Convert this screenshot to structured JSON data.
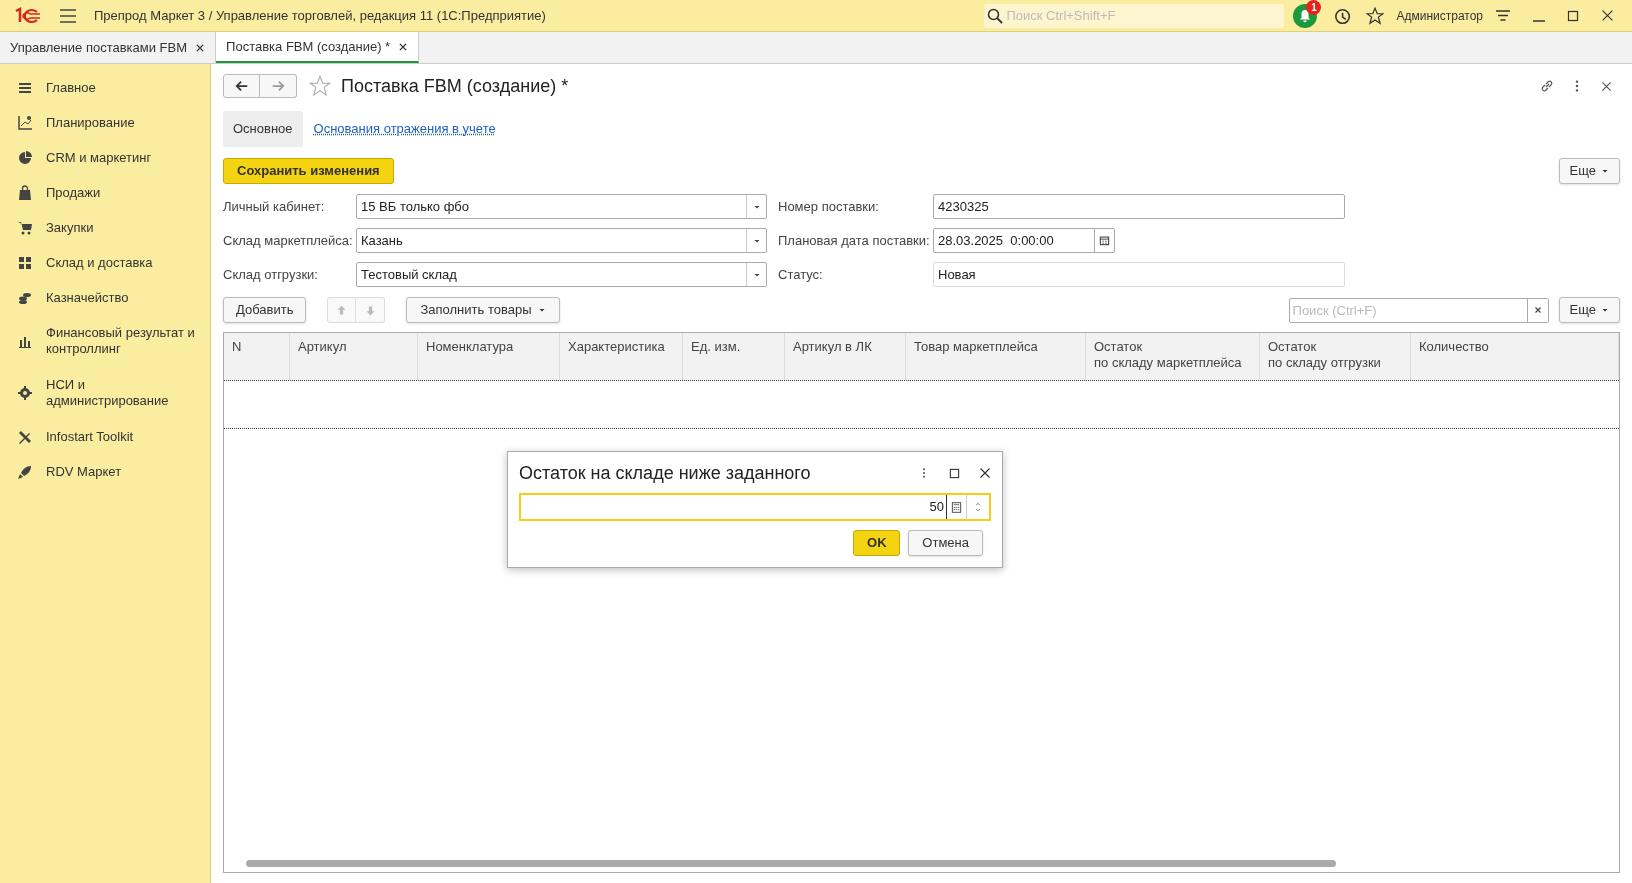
{
  "window": {
    "title": "Препрод Маркет 3 / Управление торговлей, редакция 11  (1С:Предприятие)",
    "search_placeholder": "Поиск Ctrl+Shift+F",
    "notifications": "1",
    "user": "Администратор"
  },
  "tabs": [
    {
      "label": "Управление поставками FBM",
      "selected": false
    },
    {
      "label": "Поставка FBM (создание) *",
      "selected": true
    }
  ],
  "sidebar": {
    "items": [
      {
        "label": "Главное"
      },
      {
        "label": "Планирование"
      },
      {
        "label": "CRM и маркетинг"
      },
      {
        "label": "Продажи"
      },
      {
        "label": "Закупки"
      },
      {
        "label": "Склад и доставка"
      },
      {
        "label": "Казначейство"
      },
      {
        "label": "Финансовый результат и контроллинг"
      },
      {
        "label": "НСИ и администрирование"
      },
      {
        "label": "Infostart Toolkit"
      },
      {
        "label": "RDV Маркет"
      }
    ]
  },
  "form": {
    "title": "Поставка FBM (создание) *",
    "sections": [
      {
        "label": "Основное",
        "selected": true
      },
      {
        "label": "Основания отражения в учете",
        "selected": false
      }
    ],
    "save_button": "Сохранить изменения",
    "more_button": "Еще",
    "left_fields": [
      {
        "label": "Личный кабинет:",
        "value": "15 ВБ только фбо",
        "kind": "dropdown"
      },
      {
        "label": "Склад маркетплейса:",
        "value": "Казань",
        "kind": "dropdown"
      },
      {
        "label": "Склад отгрузки:",
        "value": "Тестовый склад",
        "kind": "dropdown"
      }
    ],
    "right_fields": [
      {
        "label": "Номер поставки:",
        "value": "4230325",
        "kind": "text"
      },
      {
        "label": "Плановая дата поставки:",
        "value": "28.03.2025  0:00:00",
        "kind": "date"
      },
      {
        "label": "Статус:",
        "value": "Новая",
        "kind": "readonly"
      }
    ],
    "table_toolbar": {
      "add_button": "Добавить",
      "fill_button": "Заполнить товары",
      "search_placeholder": "Поиск (Ctrl+F)",
      "more_button": "Еще"
    },
    "table": {
      "columns": [
        [
          "N"
        ],
        [
          "Артикул"
        ],
        [
          "Номенклатура"
        ],
        [
          "Характеристика"
        ],
        [
          "Ед. изм."
        ],
        [
          "Артикул в ЛК"
        ],
        [
          "Товар маркетплейса"
        ],
        [
          "Остаток",
          "по складу маркетплейса"
        ],
        [
          "Остаток",
          "по складу отгрузки"
        ],
        [
          "Количество"
        ]
      ]
    }
  },
  "dialog": {
    "title": "Остаток на складе ниже заданного",
    "value": "50",
    "ok_button": "OK",
    "cancel_button": "Отмена"
  }
}
